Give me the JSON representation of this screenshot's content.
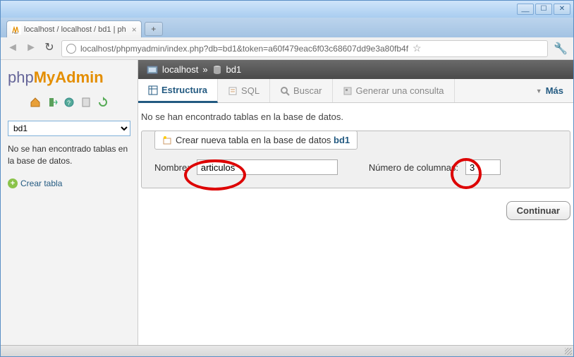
{
  "window": {
    "min": "__",
    "max": "☐",
    "close": "✕"
  },
  "tab": {
    "title": "localhost / localhost / bd1 | ph",
    "new": "+"
  },
  "address": {
    "url": "localhost/phpmyadmin/index.php?db=bd1&token=a60f479eac6f03c68607dd9e3a80fb4f"
  },
  "logo": {
    "p1": "php",
    "p2": "MyAdmin"
  },
  "sidebar": {
    "db_selected": "bd1",
    "msg": "No se han encontrado tablas en la base de datos.",
    "create": "Crear tabla"
  },
  "breadcrumb": {
    "host": "localhost",
    "db": "bd1",
    "sep": "»"
  },
  "tabs": {
    "estructura": "Estructura",
    "sql": "SQL",
    "buscar": "Buscar",
    "generar": "Generar una consulta",
    "mas": "Más"
  },
  "main": {
    "notables": "No se han encontrado tablas en la base de datos.",
    "legend_prefix": "Crear nueva tabla en la base de datos ",
    "legend_db": "bd1",
    "name_label": "Nombre:",
    "name_value": "articulos",
    "cols_label": "Número de columnas:",
    "cols_value": "3",
    "continue": "Continuar"
  }
}
